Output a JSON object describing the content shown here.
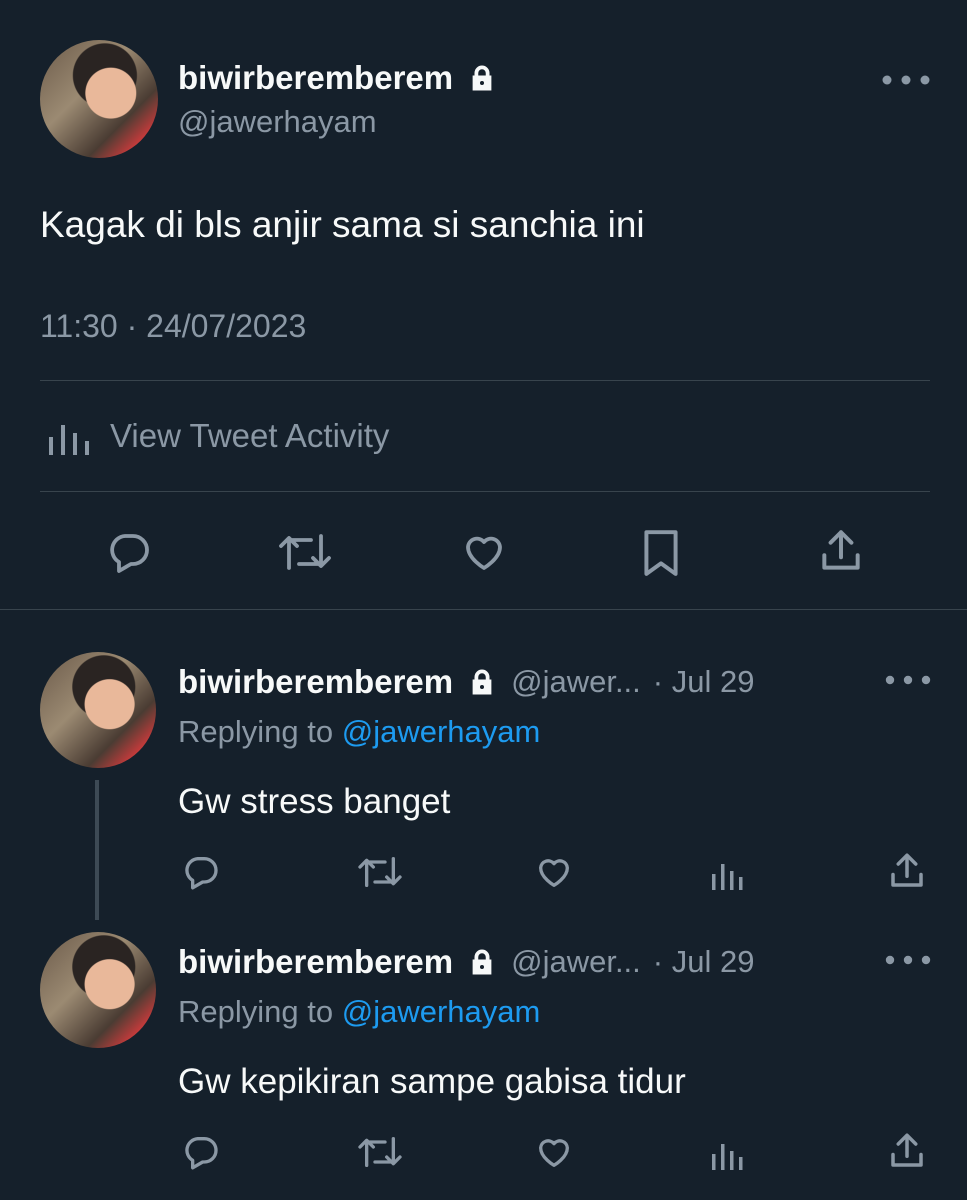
{
  "main_tweet": {
    "display_name": "biwirberemberem",
    "handle": "@jawerhayam",
    "text": "Kagak di bls anjir sama si sanchia ini",
    "timestamp": "11:30 · 24/07/2023",
    "activity_label": "View Tweet Activity"
  },
  "replies": [
    {
      "display_name": "biwirberemberem",
      "handle": "@jawer...",
      "date": "· Jul 29",
      "replying_prefix": "Replying to ",
      "replying_handle": "@jawerhayam",
      "text": "Gw stress banget"
    },
    {
      "display_name": "biwirberemberem",
      "handle": "@jawer...",
      "date": "· Jul 29",
      "replying_prefix": "Replying to ",
      "replying_handle": "@jawerhayam",
      "text": "Gw kepikiran sampe gabisa tidur"
    }
  ],
  "colors": {
    "background": "#15202b",
    "text": "#f7f9f9",
    "muted": "#8b98a5",
    "link": "#1d9bf0",
    "divider": "#38444d"
  }
}
